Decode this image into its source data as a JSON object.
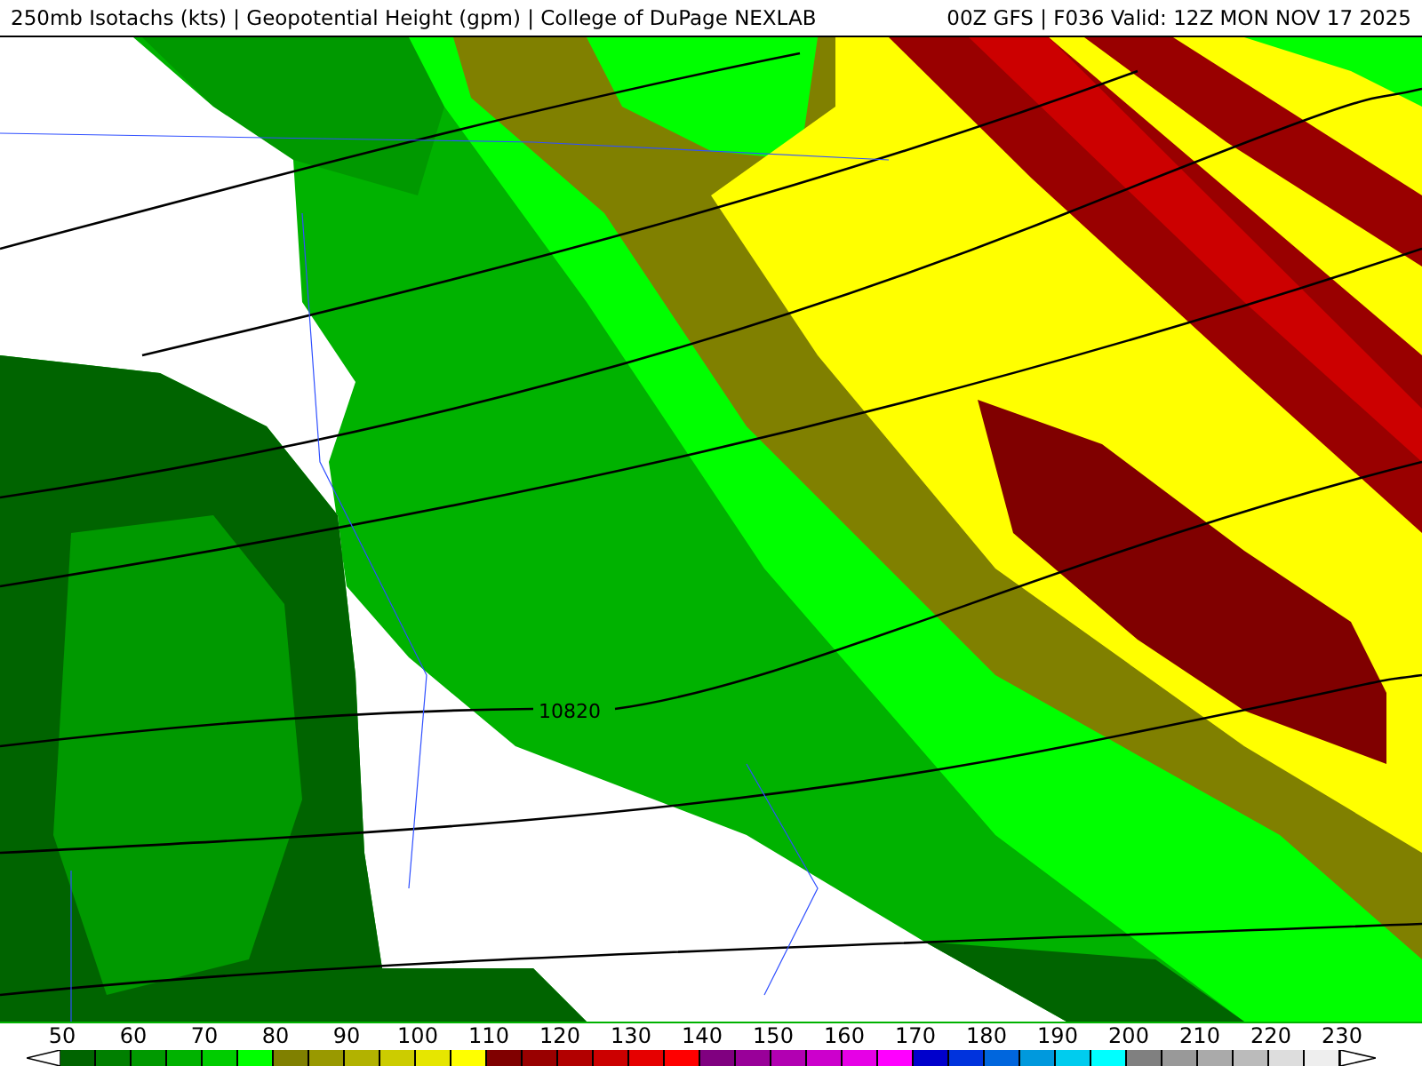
{
  "header": {
    "title": "250mb Isotachs (kts) | Geopotential Height (gpm) | College of DuPage NEXLAB",
    "run": "00Z GFS | F036 Valid: 12Z MON NOV 17 2025"
  },
  "map": {
    "contour_label": "10820"
  },
  "colorbar": {
    "labels": [
      "50",
      "60",
      "70",
      "80",
      "90",
      "100",
      "110",
      "120",
      "130",
      "140",
      "150",
      "160",
      "170",
      "180",
      "190",
      "200",
      "210",
      "220",
      "230"
    ],
    "swatches": [
      {
        "color": "#006400"
      },
      {
        "color": "#007f00"
      },
      {
        "color": "#009900"
      },
      {
        "color": "#00b200"
      },
      {
        "color": "#00cc00"
      },
      {
        "color": "#00ff00"
      },
      {
        "color": "#808000"
      },
      {
        "color": "#999900"
      },
      {
        "color": "#b2b200"
      },
      {
        "color": "#cccc00"
      },
      {
        "color": "#e6e600"
      },
      {
        "color": "#ffff00"
      },
      {
        "color": "#800000"
      },
      {
        "color": "#990000"
      },
      {
        "color": "#b20000"
      },
      {
        "color": "#cc0000"
      },
      {
        "color": "#e60000"
      },
      {
        "color": "#ff0000"
      },
      {
        "color": "#800080"
      },
      {
        "color": "#990099"
      },
      {
        "color": "#b200b2"
      },
      {
        "color": "#cc00cc"
      },
      {
        "color": "#e600e6"
      },
      {
        "color": "#ff00ff"
      },
      {
        "color": "#0000cc"
      },
      {
        "color": "#0033dd"
      },
      {
        "color": "#0066dd"
      },
      {
        "color": "#0099dd"
      },
      {
        "color": "#00ccee"
      },
      {
        "color": "#00ffff"
      },
      {
        "color": "#808080"
      },
      {
        "color": "#999999"
      },
      {
        "color": "#aaaaaa"
      },
      {
        "color": "#bbbbbb"
      },
      {
        "color": "#dddddd"
      },
      {
        "color": "#eeeeee"
      }
    ]
  }
}
